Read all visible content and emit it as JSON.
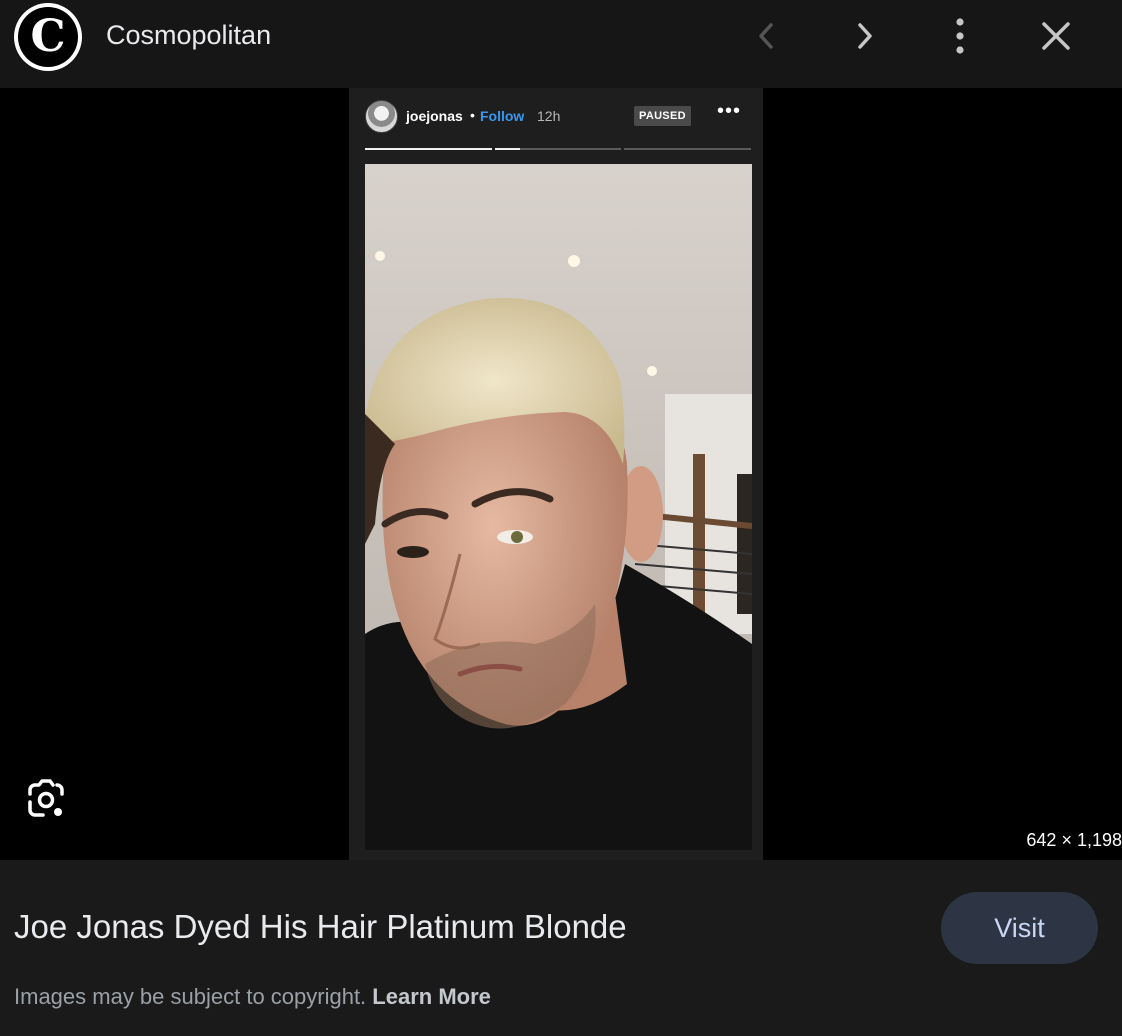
{
  "header": {
    "logo_letter": "C",
    "site_name": "Cosmopolitan",
    "icons": [
      "chevron-left-icon",
      "chevron-right-icon",
      "more-vert-icon",
      "close-icon"
    ]
  },
  "story": {
    "username": "joejonas",
    "separator": "•",
    "follow_label": "Follow",
    "time": "12h",
    "status_badge": "PAUSED",
    "more_label": "•••",
    "progress_segments": [
      1,
      0.2,
      0
    ],
    "follow_color": "#3897f0"
  },
  "viewer": {
    "dimensions": "642 × 1,198"
  },
  "result": {
    "title": "Joe Jonas Dyed His Hair Platinum Blonde",
    "visit_label": "Visit",
    "copyright_text": "Images may be subject to copyright.",
    "learn_more_label": "Learn More"
  },
  "colors": {
    "background": "#131313",
    "visit_button": "#2d3544",
    "visit_text": "#c9d7f5"
  }
}
